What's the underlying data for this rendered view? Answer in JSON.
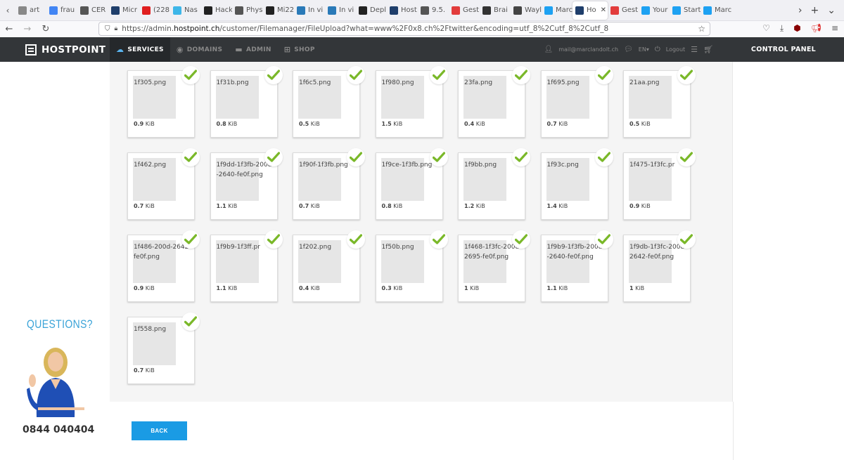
{
  "browser": {
    "tabs": [
      {
        "label": "art",
        "icon": "generic-tab-icon",
        "color": "#888888"
      },
      {
        "label": "frau",
        "icon": "google-icon",
        "color": "#4285f4"
      },
      {
        "label": "CER",
        "icon": "at-sign-icon",
        "color": "#555555"
      },
      {
        "label": "Micr",
        "icon": "app-icon",
        "color": "#1f3e6b"
      },
      {
        "label": "(228",
        "icon": "youtube-icon",
        "color": "#e01f1f"
      },
      {
        "label": "Nas",
        "icon": "app-icon",
        "color": "#3db6e8"
      },
      {
        "label": "Hack",
        "icon": "github-icon",
        "color": "#222222"
      },
      {
        "label": "Phys",
        "icon": "app-icon",
        "color": "#555555"
      },
      {
        "label": "Mi22",
        "icon": "m-icon",
        "color": "#222222"
      },
      {
        "label": "In vi",
        "icon": "link-icon",
        "color": "#2a7ab8"
      },
      {
        "label": "In vi",
        "icon": "link-icon",
        "color": "#2a7ab8"
      },
      {
        "label": "Depl",
        "icon": "github-icon",
        "color": "#222222"
      },
      {
        "label": "Host",
        "icon": "hostpoint-icon",
        "color": "#1f3e6b"
      },
      {
        "label": "9.5.",
        "icon": "ok-icon",
        "color": "#555555"
      },
      {
        "label": "Gest",
        "icon": "app-icon",
        "color": "#e23c3c"
      },
      {
        "label": "Brai",
        "icon": "brain-icon",
        "color": "#333333"
      },
      {
        "label": "Wayl",
        "icon": "app-icon",
        "color": "#444444"
      },
      {
        "label": "Marc",
        "icon": "twitter-icon",
        "color": "#1da1f2"
      },
      {
        "label": "Ho",
        "icon": "hostpoint-icon",
        "color": "#1f3e6b",
        "active": true
      },
      {
        "label": "Gest",
        "icon": "app-icon",
        "color": "#e23c3c"
      },
      {
        "label": "Your",
        "icon": "twitter-icon",
        "color": "#1da1f2"
      },
      {
        "label": "Start",
        "icon": "twitter-icon",
        "color": "#1da1f2"
      },
      {
        "label": "Marc",
        "icon": "twitter-icon",
        "color": "#1da1f2"
      }
    ],
    "url_prefix": "https://admin.",
    "url_host": "hostpoint.ch",
    "url_path": "/customer/Filemanager/FileUpload?what=www%2F0x8.ch%2Ftwitter&encoding=utf_8%2Cutf_8%2Cutf_8"
  },
  "header": {
    "logo": "HOSTPOINT",
    "nav": [
      {
        "label": "SERVICES",
        "icon": "cloud-icon",
        "active": true
      },
      {
        "label": "DOMAINS",
        "icon": "globe-icon",
        "active": false
      },
      {
        "label": "ADMIN",
        "icon": "server-icon",
        "active": false
      },
      {
        "label": "SHOP",
        "icon": "plus-box-icon",
        "active": false
      }
    ],
    "user_email": "mail@marclandolt.ch",
    "language": "EN",
    "logout": "Logout",
    "control_panel": "CONTROL PANEL"
  },
  "files": [
    {
      "name": "1f305.png",
      "size": "0.9",
      "unit": "KiB"
    },
    {
      "name": "1f31b.png",
      "size": "0.8",
      "unit": "KiB"
    },
    {
      "name": "1f6c5.png",
      "size": "0.5",
      "unit": "KiB"
    },
    {
      "name": "1f980.png",
      "size": "1.5",
      "unit": "KiB"
    },
    {
      "name": "23fa.png",
      "size": "0.4",
      "unit": "KiB"
    },
    {
      "name": "1f695.png",
      "size": "0.7",
      "unit": "KiB"
    },
    {
      "name": "21aa.png",
      "size": "0.5",
      "unit": "KiB"
    },
    {
      "name": "1f462.png",
      "size": "0.7",
      "unit": "KiB"
    },
    {
      "name": "1f9dd-1f3fb-200d-2640-fe0f.png",
      "size": "1.1",
      "unit": "KiB"
    },
    {
      "name": "1f90f-1f3fb.png",
      "size": "0.7",
      "unit": "KiB"
    },
    {
      "name": "1f9ce-1f3fb.png",
      "size": "0.8",
      "unit": "KiB"
    },
    {
      "name": "1f9bb.png",
      "size": "1.2",
      "unit": "KiB"
    },
    {
      "name": "1f93c.png",
      "size": "1.4",
      "unit": "KiB"
    },
    {
      "name": "1f475-1f3fc.pr",
      "size": "0.9",
      "unit": "KiB"
    },
    {
      "name": "1f486-200d-2642-fe0f.png",
      "size": "0.9",
      "unit": "KiB"
    },
    {
      "name": "1f9b9-1f3ff.pr",
      "size": "1.1",
      "unit": "KiB"
    },
    {
      "name": "1f202.png",
      "size": "0.4",
      "unit": "KiB"
    },
    {
      "name": "1f50b.png",
      "size": "0.3",
      "unit": "KiB"
    },
    {
      "name": "1f468-1f3fc-200d-2695-fe0f.png",
      "size": "1",
      "unit": "KiB"
    },
    {
      "name": "1f9b9-1f3fb-200d-2640-fe0f.png",
      "size": "1.1",
      "unit": "KiB"
    },
    {
      "name": "1f9db-1f3fc-200d-2642-fe0f.png",
      "size": "1",
      "unit": "KiB"
    },
    {
      "name": "1f558.png",
      "size": "0.7",
      "unit": "KiB"
    }
  ],
  "support": {
    "title": "QUESTIONS?",
    "phone": "0844 040404"
  },
  "back_button": "BACK",
  "colors": {
    "accent": "#1a9be4",
    "check": "#7ab829",
    "header_bg": "#333639"
  }
}
